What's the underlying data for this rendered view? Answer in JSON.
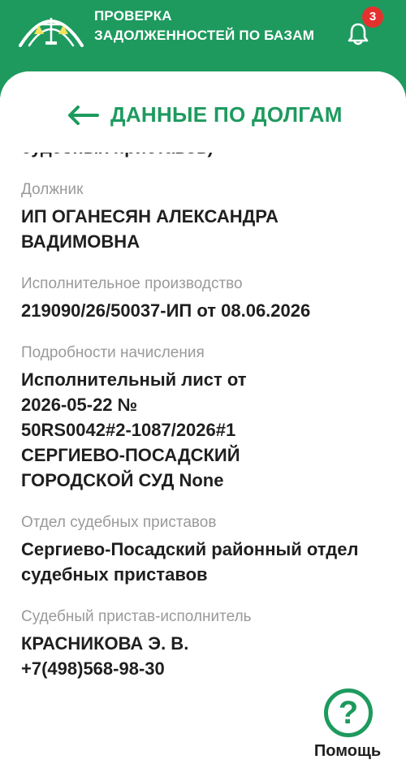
{
  "header": {
    "title_line1": "ПРОВЕРКА",
    "title_line2": "ЗАДОЛЖЕННОСТЕЙ ПО БАЗАМ",
    "notification_count": "3",
    "logo_icon": "scales-emblem-icon",
    "bell_icon": "bell-icon"
  },
  "section": {
    "back_icon": "arrow-left-icon",
    "title": "ДАННЫЕ ПО ДОЛГАМ"
  },
  "continued_text": "судебных приставов)",
  "fields": [
    {
      "label": "Должник",
      "value": "ИП ОГАНЕСЯН АЛЕКСАНДРА ВАДИМОВНА"
    },
    {
      "label": "Исполнительное производство",
      "value": "219090/26/50037-ИП от 08.06.2026"
    },
    {
      "label": "Подробности начисления",
      "value_lines": [
        "Исполнительный лист от",
        "2026-05-22 №",
        "50RS0042#2-1087/2026#1",
        "СЕРГИЕВО-ПОСАДСКИЙ",
        "ГОРОДСКОЙ СУД None"
      ]
    },
    {
      "label": "Отдел судебных приставов",
      "value": "Сергиево-Посадский районный отдел судебных приставов"
    },
    {
      "label": "Судебный пристав-исполнитель",
      "value_lines": [
        "КРАСНИКОВА Э. В.",
        "+7(498)568-98-30"
      ]
    }
  ],
  "help": {
    "icon": "question-mark-icon",
    "glyph": "?",
    "label": "Помощь"
  },
  "colors": {
    "brand_green": "#1e9a5f",
    "badge_red": "#e5312e",
    "label_gray": "#9a9a9a",
    "value_text": "#1f1f1f"
  }
}
